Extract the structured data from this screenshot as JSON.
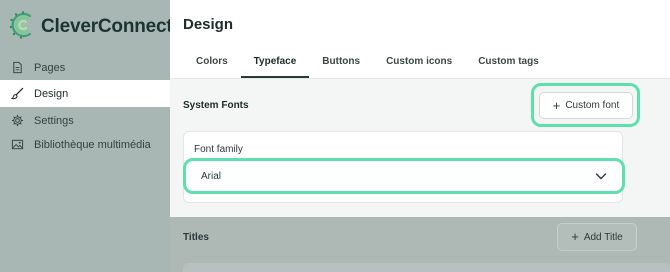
{
  "app": {
    "logo_text": "CleverConnect",
    "brand_color": "#5ee0ad",
    "logo_icon": "cleverconnect-logo-icon"
  },
  "sidebar": {
    "items": [
      {
        "label": "Pages",
        "icon": "page-icon",
        "active": false
      },
      {
        "label": "Design",
        "icon": "brush-icon",
        "active": true
      },
      {
        "label": "Settings",
        "icon": "gear-icon",
        "active": false
      },
      {
        "label": "Bibliothèque multimédia",
        "icon": "image-icon",
        "active": false
      }
    ]
  },
  "header": {
    "title": "Design"
  },
  "tabs": [
    {
      "label": "Colors",
      "active": false
    },
    {
      "label": "Typeface",
      "active": true
    },
    {
      "label": "Buttons",
      "active": false
    },
    {
      "label": "Custom icons",
      "active": false
    },
    {
      "label": "Custom tags",
      "active": false
    }
  ],
  "system_fonts": {
    "title": "System Fonts",
    "custom_font_button": "Custom font",
    "field_label": "Font family",
    "selected_value": "Arial"
  },
  "titles_section": {
    "title": "Titles",
    "add_title_button": "Add Title"
  }
}
